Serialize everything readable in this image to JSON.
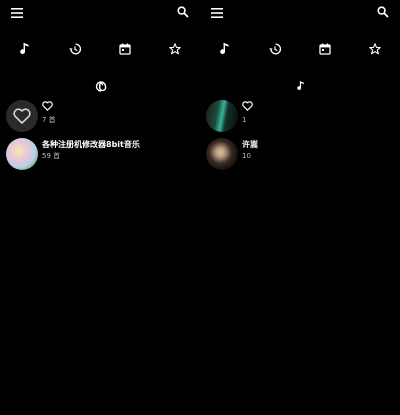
{
  "colors": {
    "background": "#000000",
    "text_primary": "#ffffff",
    "text_secondary": "#bdbdbd"
  },
  "icons": {
    "menu": "hamburger-menu-icon",
    "search": "search-icon",
    "tabs": [
      "music-note-icon",
      "history-icon",
      "calendar-icon",
      "star-icon"
    ],
    "left_section": "swirl-icon",
    "right_section": "music-note-icon"
  },
  "left": {
    "items": [
      {
        "title": "",
        "title_icon": "heart-icon",
        "sub": "7 首"
      },
      {
        "title": "各种注册机修改器8bit音乐",
        "sub": "59 首"
      }
    ]
  },
  "right": {
    "items": [
      {
        "title": "",
        "title_icon": "heart-icon",
        "sub": "1"
      },
      {
        "title": "许嵩",
        "sub": "10"
      }
    ]
  }
}
